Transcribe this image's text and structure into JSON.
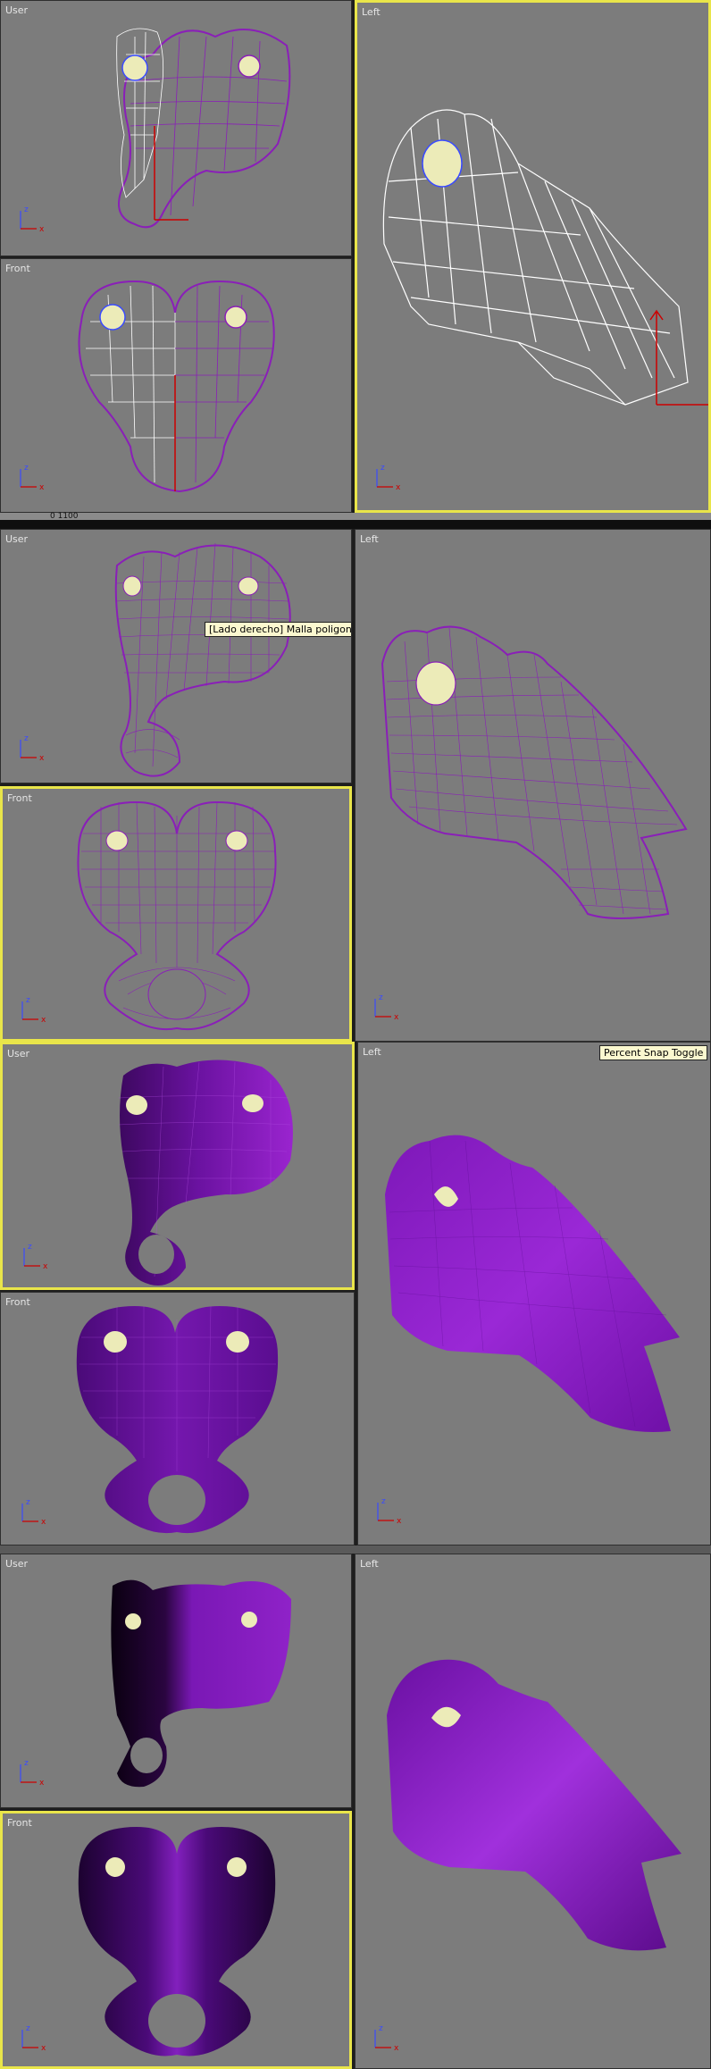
{
  "viewports": {
    "row1": {
      "user": "User",
      "front": "Front",
      "left": "Left"
    },
    "row2": {
      "user": "User",
      "front": "Front",
      "left": "Left"
    },
    "row3": {
      "user": "User",
      "front": "Front",
      "left": "Left"
    },
    "row4": {
      "user": "User",
      "front": "Front",
      "left": "Left"
    }
  },
  "status": {
    "ruler_value": "0 1100"
  },
  "tooltips": {
    "object_name": "[Lado derecho] Malla poligonal01",
    "snap_toggle": "Percent Snap Toggle"
  },
  "colors": {
    "viewport_bg": "#7c7c7c",
    "active_border": "#e9e54a",
    "mesh_purple": "#8a1fb8",
    "wire_white": "#ffffff",
    "eye": "#ecebb8"
  },
  "icons": [
    "axis-tripod-icon",
    "transform-gizmo-icon"
  ]
}
